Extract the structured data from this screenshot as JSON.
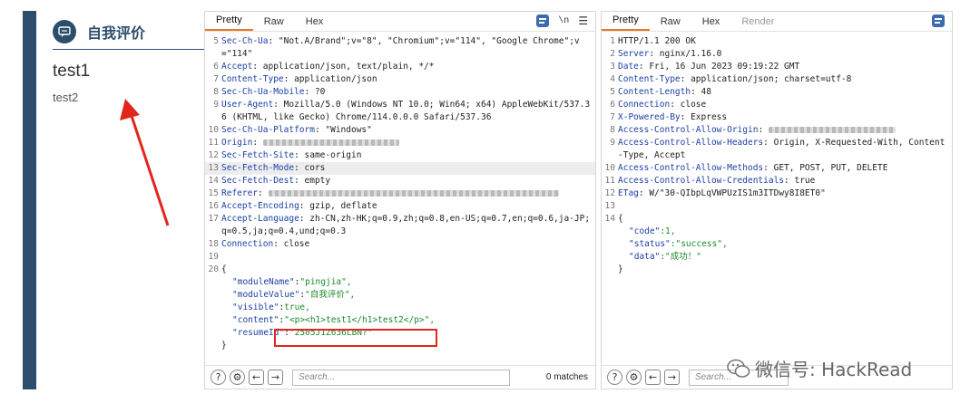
{
  "left_page": {
    "section_title": "自我评价",
    "h1": "test1",
    "p": "test2"
  },
  "request": {
    "tabs": [
      "Pretty",
      "Raw",
      "Hex"
    ],
    "active_tab": "Pretty",
    "lines": [
      {
        "n": "5",
        "name": "Sec-Ch-Ua",
        "value": ": \"Not.A/Brand\";v=\"8\", \"Chromium\";v=\"114\", \"Google Chrome\";v=\"114\""
      },
      {
        "n": "6",
        "name": "Accept",
        "value": ": application/json, text/plain, */*"
      },
      {
        "n": "7",
        "name": "Content-Type",
        "value": ": application/json"
      },
      {
        "n": "8",
        "name": "Sec-Ch-Ua-Mobile",
        "value": ": ?0"
      },
      {
        "n": "9",
        "name": "User-Agent",
        "value": ": Mozilla/5.0 (Windows NT 10.0; Win64; x64) AppleWebKit/537.36 (KHTML, like Gecko) Chrome/114.0.0.0 Safari/537.36"
      },
      {
        "n": "10",
        "name": "Sec-Ch-Ua-Platform",
        "value": ": \"Windows\""
      },
      {
        "n": "11",
        "name": "Origin",
        "value": ": "
      },
      {
        "n": "12",
        "name": "Sec-Fetch-Site",
        "value": ": same-origin"
      },
      {
        "n": "13",
        "name": "Sec-Fetch-Mode",
        "value": ": cors"
      },
      {
        "n": "14",
        "name": "Sec-Fetch-Dest",
        "value": ": empty"
      },
      {
        "n": "15",
        "name": "Referer",
        "value": ": "
      },
      {
        "n": "16",
        "name": "Accept-Encoding",
        "value": ": gzip, deflate"
      },
      {
        "n": "17",
        "name": "Accept-Language",
        "value": ": zh-CN,zh-HK;q=0.9,zh;q=0.8,en-US;q=0.7,en;q=0.6,ja-JP;q=0.5,ja;q=0.4,und;q=0.3"
      },
      {
        "n": "18",
        "name": "Connection",
        "value": ": close"
      },
      {
        "n": "19",
        "name": "",
        "value": ""
      }
    ],
    "body": {
      "n": "20",
      "open": "{",
      "close": "}",
      "fields": [
        {
          "key": "\"moduleName\"",
          "value": "\"pingjia\","
        },
        {
          "key": "\"moduleValue\"",
          "value": "\"自我评价\","
        },
        {
          "key": "\"visible\"",
          "value": "true,"
        },
        {
          "key": "\"content\"",
          "value": "\"<p><h1>test1</h1>test2</p>\","
        },
        {
          "key": "\"resumeId\"",
          "value": "\"2505J1Z636LBN?\""
        }
      ]
    },
    "search_placeholder": "Search...",
    "matches": "0 matches"
  },
  "response": {
    "tabs": [
      "Pretty",
      "Raw",
      "Hex",
      "Render"
    ],
    "active_tab": "Pretty",
    "status_line": {
      "n": "1",
      "text": "HTTP/1.1 200 OK"
    },
    "lines": [
      {
        "n": "2",
        "name": "Server",
        "value": ": nginx/1.16.0"
      },
      {
        "n": "3",
        "name": "Date",
        "value": ": Fri, 16 Jun 2023 09:19:22 GMT"
      },
      {
        "n": "4",
        "name": "Content-Type",
        "value": ": application/json; charset=utf-8"
      },
      {
        "n": "5",
        "name": "Content-Length",
        "value": ": 48"
      },
      {
        "n": "6",
        "name": "Connection",
        "value": ": close"
      },
      {
        "n": "7",
        "name": "X-Powered-By",
        "value": ": Express"
      },
      {
        "n": "8",
        "name": "Access-Control-Allow-Origin",
        "value": ": "
      },
      {
        "n": "9",
        "name": "Access-Control-Allow-Headers",
        "value": ": Origin, X-Requested-With, Content-Type, Accept"
      },
      {
        "n": "10",
        "name": "Access-Control-Allow-Methods",
        "value": ": GET, POST, PUT, DELETE"
      },
      {
        "n": "11",
        "name": "Access-Control-Allow-Credentials",
        "value": ": true"
      },
      {
        "n": "12",
        "name": "ETag",
        "value": ": W/\"30-QIbpLqVWPUzIS1m3ITDwy8I8ET0\""
      },
      {
        "n": "13",
        "name": "",
        "value": ""
      }
    ],
    "body": {
      "n": "14",
      "open": "{",
      "close": "}",
      "fields": [
        {
          "key": "\"code\"",
          "value": ":1,"
        },
        {
          "key": "\"status\"",
          "value": ":\"success\","
        },
        {
          "key": "\"data\"",
          "value": ":\"成功！\""
        }
      ]
    },
    "search_placeholder": "Search..."
  },
  "watermark": "微信号: HackRead",
  "colors": {
    "accent_orange": "#e8752a",
    "header_blue": "#1b3fa6",
    "string_green": "#1d8a29",
    "highlight_red": "#e1261c",
    "sidebar_navy": "#2d4d6d"
  }
}
